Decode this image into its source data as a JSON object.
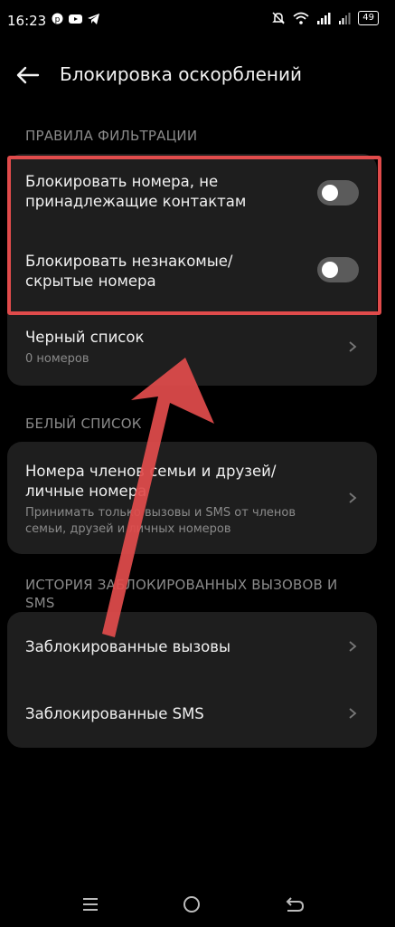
{
  "status_bar": {
    "time": "16:23",
    "battery": "49"
  },
  "header": {
    "title": "Блокировка оскорблений"
  },
  "filter_rules": {
    "section_label": "ПРАВИЛА ФИЛЬТРАЦИИ",
    "block_non_contacts": {
      "label": "Блокировать номера, не принадлежащие контактам",
      "state": "off"
    },
    "block_unknown_hidden": {
      "label": "Блокировать незнакомые/ скрытые номера",
      "state": "off"
    },
    "blacklist": {
      "label": "Черный список",
      "count": "0  номеров"
    }
  },
  "whitelist": {
    "section_label": "БЕЛЫЙ СПИСОК",
    "family_friends": {
      "label": "Номера членов семьи и друзей/ личные номера",
      "description": "Принимать только вызовы и SMS от членов семьи, друзей и личных номеров"
    }
  },
  "history": {
    "section_label": "ИСТОРИЯ ЗАБЛОКИРОВАННЫХ ВЫЗОВОВ И SMS",
    "blocked_calls": "Заблокированные вызовы",
    "blocked_sms": "Заблокированные SMS"
  },
  "annotation": {
    "highlight_color": "#e04b4b",
    "arrow_color": "#e04b4b"
  }
}
